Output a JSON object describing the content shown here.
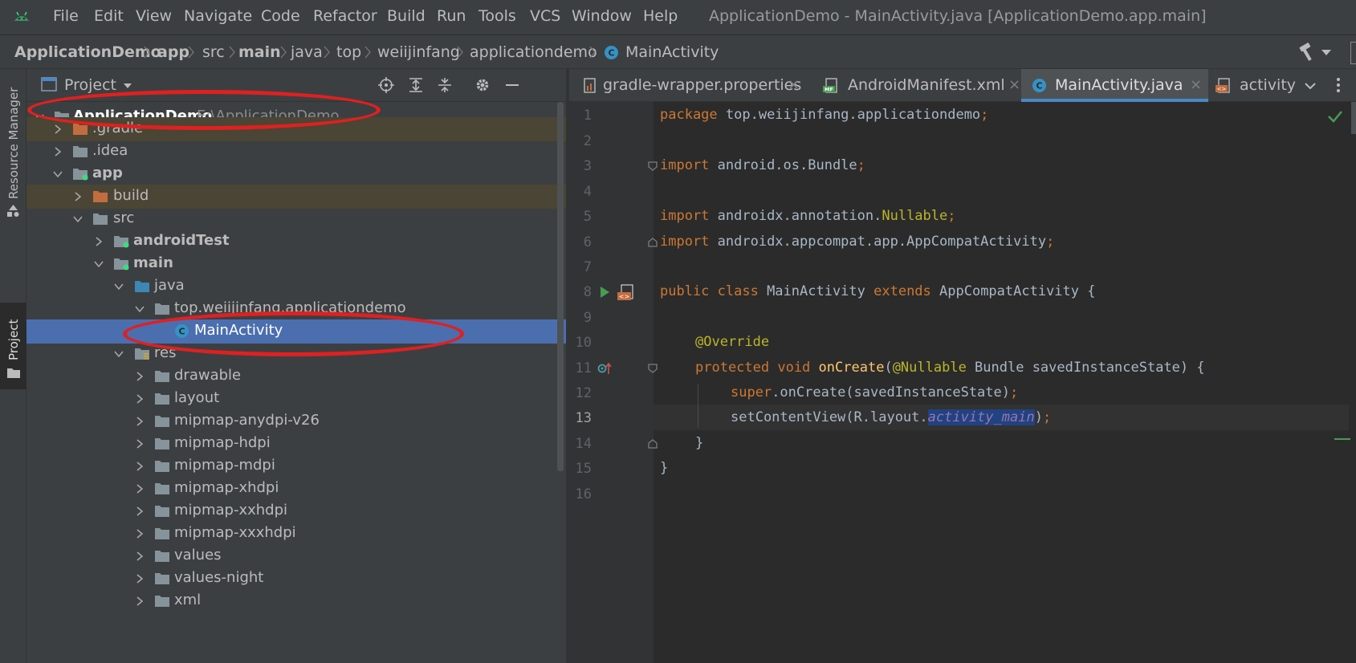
{
  "menubar": {
    "items": [
      "File",
      "Edit",
      "View",
      "Navigate",
      "Code",
      "Refactor",
      "Build",
      "Run",
      "Tools",
      "VCS",
      "Window",
      "Help"
    ],
    "title": "ApplicationDemo - MainActivity.java [ApplicationDemo.app.main]"
  },
  "breadcrumb": [
    "ApplicationDemo",
    "app",
    "src",
    "main",
    "java",
    "top",
    "weiijinfang",
    "applicationdemo",
    "MainActivity"
  ],
  "sidebar": {
    "resource_manager": "Resource Manager",
    "project": "Project"
  },
  "project_panel": {
    "title": "Project"
  },
  "tree": [
    {
      "label": "ApplicationDemo",
      "path": "E:\\ApplicationDemo"
    },
    {
      "label": ".gradle"
    },
    {
      "label": ".idea"
    },
    {
      "label": "app"
    },
    {
      "label": "build"
    },
    {
      "label": "src"
    },
    {
      "label": "androidTest"
    },
    {
      "label": "main"
    },
    {
      "label": "java"
    },
    {
      "label": "top.weiijinfang.applicationdemo"
    },
    {
      "label": "MainActivity"
    },
    {
      "label": "res"
    },
    {
      "label": "drawable"
    },
    {
      "label": "layout"
    },
    {
      "label": "mipmap-anydpi-v26"
    },
    {
      "label": "mipmap-hdpi"
    },
    {
      "label": "mipmap-mdpi"
    },
    {
      "label": "mipmap-xhdpi"
    },
    {
      "label": "mipmap-xxhdpi"
    },
    {
      "label": "mipmap-xxxhdpi"
    },
    {
      "label": "values"
    },
    {
      "label": "values-night"
    },
    {
      "label": "xml"
    }
  ],
  "tabs": [
    {
      "label": "gradle-wrapper.properties"
    },
    {
      "label": "AndroidManifest.xml"
    },
    {
      "label": "MainActivity.java"
    },
    {
      "label": "activity"
    }
  ],
  "editor": {
    "line_numbers": [
      "1",
      "2",
      "3",
      "4",
      "5",
      "6",
      "7",
      "8",
      "9",
      "10",
      "11",
      "12",
      "13",
      "14",
      "15",
      "16"
    ],
    "code": {
      "l1a": "package",
      "l1b": " top.weiijinfang.applicationdemo",
      "l3a": "import",
      "l3b": " android.os.Bundle",
      "l5a": "import",
      "l5b": " androidx.annotation.",
      "l5c": "Nullable",
      "l6a": "import",
      "l6b": " androidx.appcompat.app.AppCompatActivity",
      "l8a": "public class",
      "l8b": " MainActivity ",
      "l8c": "extends",
      "l8d": " AppCompatActivity {",
      "l10": "@Override",
      "l11a": "protected void",
      "l11b": "onCreate",
      "l11c": "(",
      "l11d": "@Nullable",
      "l11e": " Bundle savedInstanceState) {",
      "l12a": "super",
      "l12b": ".onCreate(savedInstanceState)",
      "l13a": "setContentView(R.layout.",
      "l13b": "activity_main",
      "l13c": ")",
      "l14": "}",
      "l15": "}",
      "semi": ";"
    }
  }
}
